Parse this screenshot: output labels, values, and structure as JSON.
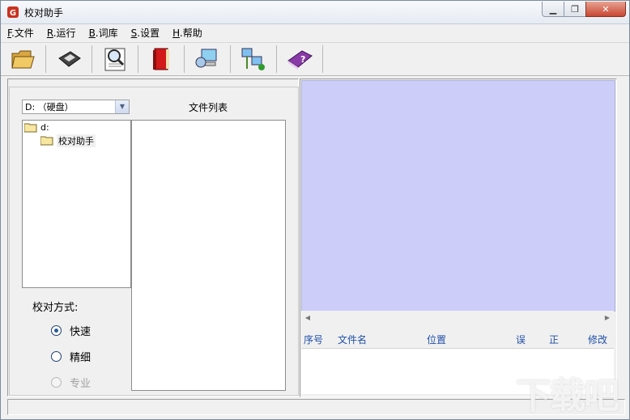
{
  "window": {
    "title": "校对助手"
  },
  "menu": [
    {
      "key": "F",
      "label": ".文件"
    },
    {
      "key": "R",
      "label": ".运行"
    },
    {
      "key": "B",
      "label": ".词库"
    },
    {
      "key": "S",
      "label": ".设置"
    },
    {
      "key": "H",
      "label": ".帮助"
    }
  ],
  "toolbar": [
    "open-folder-icon",
    "save-disk-icon",
    "proofread-doc-icon",
    "dictionary-book-icon",
    "network-computer-icon",
    "network-settings-icon",
    "help-book-icon"
  ],
  "left": {
    "drive_select_value": "D: （硬盘）",
    "file_list_label": "文件列表",
    "tree": {
      "root": "d:",
      "child": "校对助手"
    },
    "mode_label": "校对方式:",
    "modes": [
      {
        "label": "快速",
        "checked": true,
        "disabled": false
      },
      {
        "label": "精细",
        "checked": false,
        "disabled": false
      },
      {
        "label": "专业",
        "checked": false,
        "disabled": true
      }
    ]
  },
  "results": {
    "columns": [
      "序号",
      "文件名",
      "位置",
      "误",
      "正",
      "修改"
    ]
  },
  "watermark": "下载吧",
  "colors": {
    "preview_bg": "#cccdf9",
    "header_text": "#1e4fa8"
  }
}
